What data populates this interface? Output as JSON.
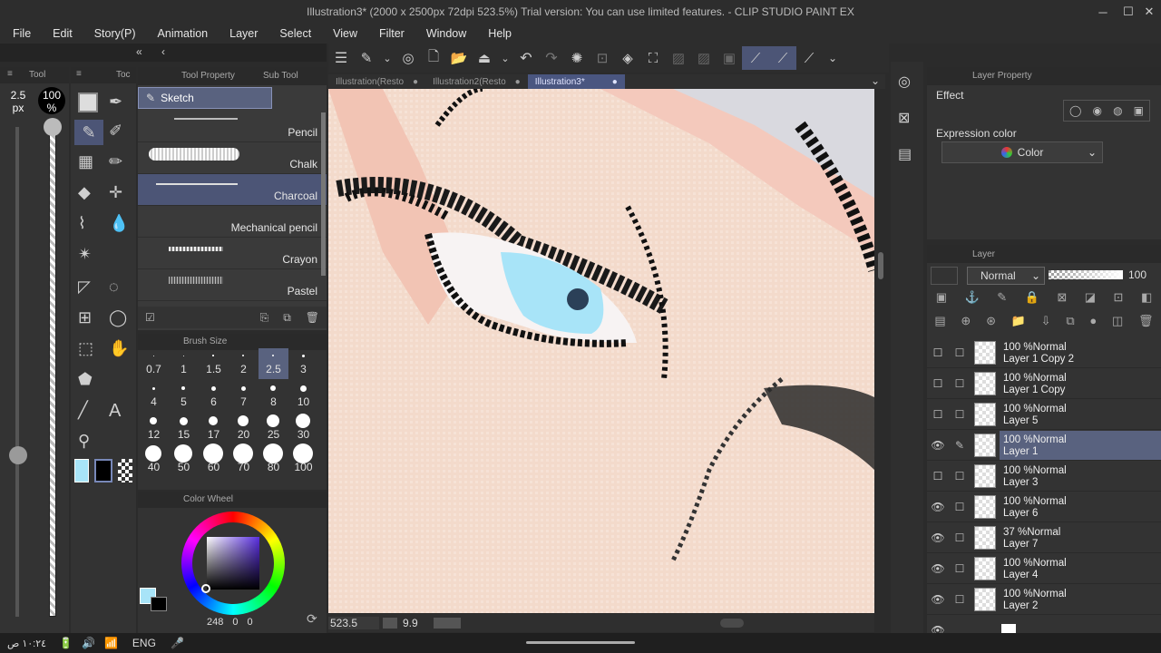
{
  "window": {
    "title": "Illustration3* (2000 x 2500px 72dpi 523.5%)  Trial version: You can use limited features. - CLIP STUDIO PAINT EX"
  },
  "menu": [
    "File",
    "Edit",
    "Story(P)",
    "Animation",
    "Layer",
    "Select",
    "View",
    "Filter",
    "Window",
    "Help"
  ],
  "left_panel": {
    "tool_tab": "Tool",
    "tool2_tab": "Toc",
    "size_value": "2.5",
    "size_unit": "px",
    "opacity": "100",
    "opacity_unit": "%"
  },
  "subtool": {
    "tool_property_tab": "Tool Property",
    "sub_tool_tab": "Sub Tool",
    "group": "Sketch",
    "brushes": [
      {
        "label": "Pencil",
        "selected": false
      },
      {
        "label": "Chalk",
        "selected": false
      },
      {
        "label": "Charcoal",
        "selected": true
      },
      {
        "label": "Mechanical pencil",
        "selected": false
      },
      {
        "label": "Crayon",
        "selected": false
      },
      {
        "label": "Pastel",
        "selected": false
      }
    ]
  },
  "brush_size": {
    "title": "Brush Size",
    "sizes": [
      "0.7",
      "1",
      "1.5",
      "2",
      "2.5",
      "3",
      "4",
      "5",
      "6",
      "7",
      "8",
      "10",
      "12",
      "15",
      "17",
      "20",
      "25",
      "30",
      "40",
      "50",
      "60",
      "70",
      "80",
      "100"
    ],
    "selected": "2.5"
  },
  "color_wheel": {
    "title": "Color Wheel",
    "h": "248",
    "s": "0",
    "v": "0"
  },
  "tabs": [
    {
      "label": "Illustration(Resto",
      "active": false
    },
    {
      "label": "Illustration2(Resto",
      "active": false
    },
    {
      "label": "Illustration3*",
      "active": true
    }
  ],
  "status": {
    "zoom": "523.5",
    "angle": "9.9"
  },
  "layer_property": {
    "title": "Layer Property",
    "effect": "Effect",
    "expression_color": "Expression color",
    "color_value": "Color"
  },
  "layer_panel": {
    "title": "Layer",
    "blend_mode": "Normal",
    "opacity": "100",
    "layers": [
      {
        "mode": "100 %Normal",
        "name": "Layer 1 Copy 2",
        "visible": false,
        "selected": false
      },
      {
        "mode": "100 %Normal",
        "name": "Layer 1 Copy",
        "visible": false,
        "selected": false
      },
      {
        "mode": "100 %Normal",
        "name": "Layer 5",
        "visible": false,
        "selected": false
      },
      {
        "mode": "100 %Normal",
        "name": "Layer 1",
        "visible": true,
        "selected": true
      },
      {
        "mode": "100 %Normal",
        "name": "Layer 3",
        "visible": false,
        "selected": false
      },
      {
        "mode": "100 %Normal",
        "name": "Layer 6",
        "visible": true,
        "selected": false
      },
      {
        "mode": "37 %Normal",
        "name": "Layer 7",
        "visible": true,
        "selected": false
      },
      {
        "mode": "100 %Normal",
        "name": "Layer 4",
        "visible": true,
        "selected": false
      },
      {
        "mode": "100 %Normal",
        "name": "Layer 2",
        "visible": true,
        "selected": false
      }
    ]
  },
  "taskbar": {
    "time": "١٠:٢٤ ص",
    "lang": "ENG"
  },
  "colors": {
    "main_color": "#a8e4f8",
    "sub_color": "#000000",
    "accent": "#59627f"
  }
}
